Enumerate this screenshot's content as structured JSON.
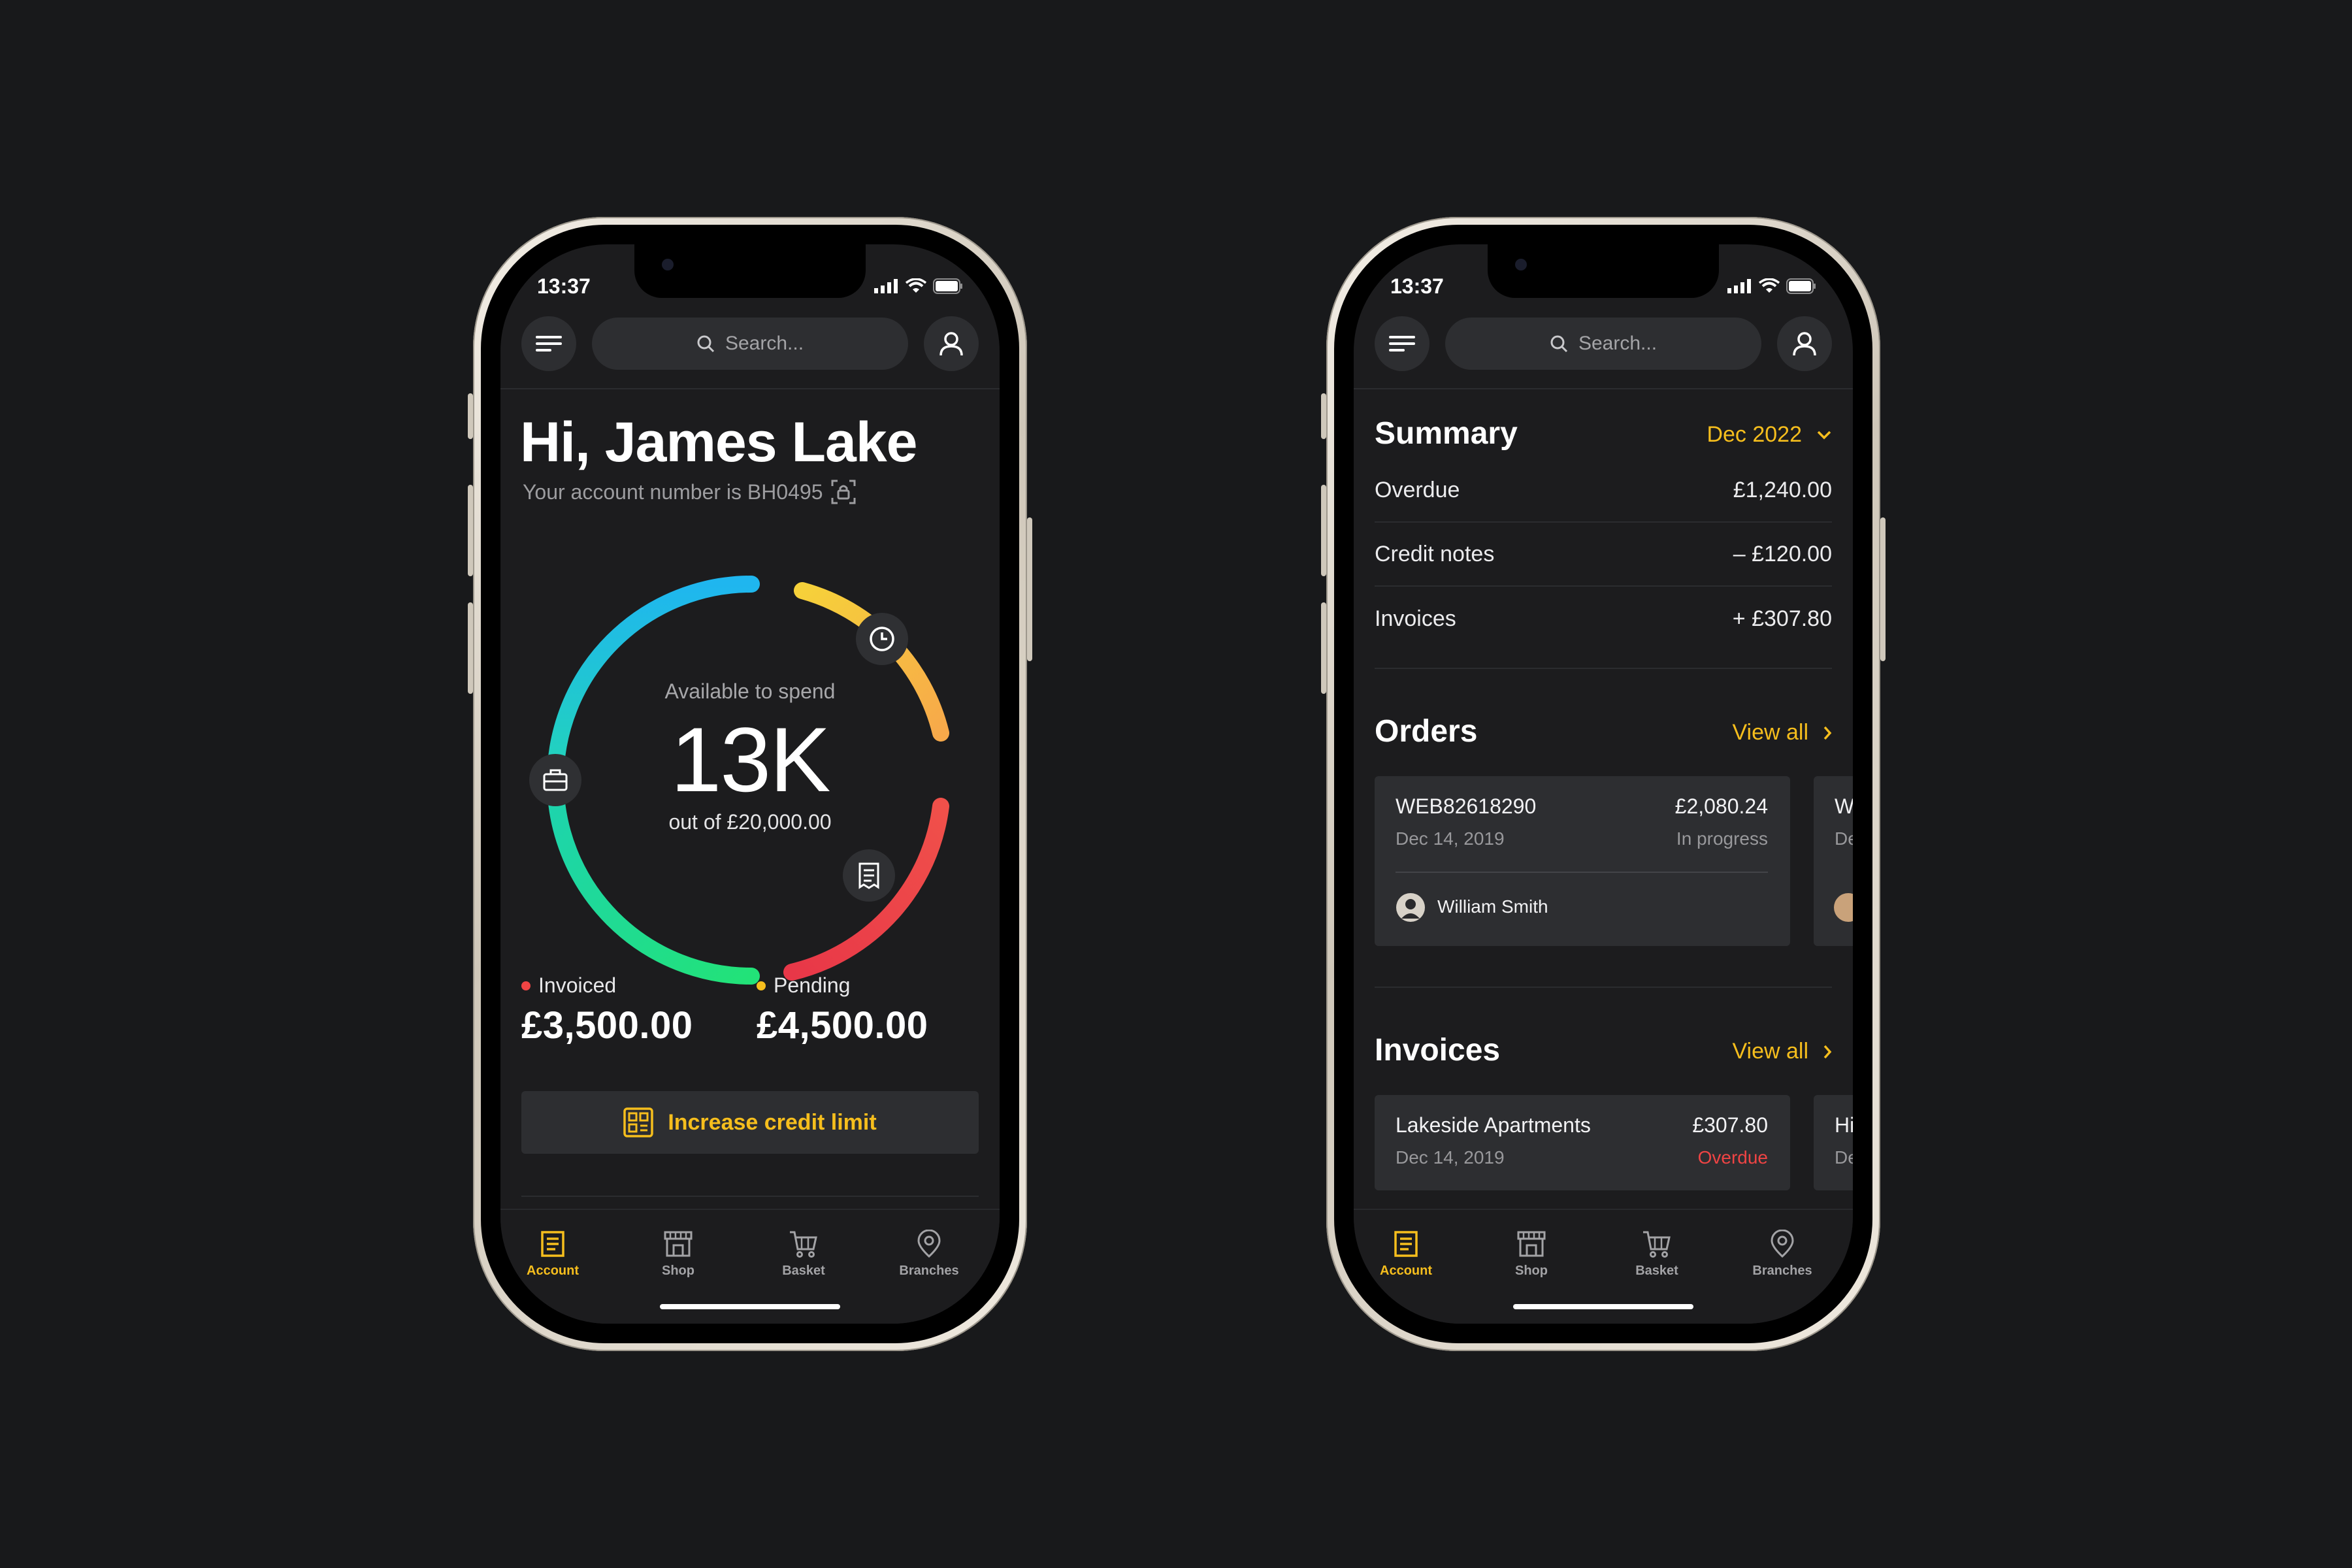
{
  "status_time": "13:37",
  "search_placeholder": "Search...",
  "left": {
    "greeting": "Hi, James Lake",
    "account_line": "Your account number is BH0495",
    "gauge": {
      "label": "Available to spend",
      "value": "13K",
      "subtitle": "out of £20,000.00"
    },
    "invoiced": {
      "label": "Invoiced",
      "amount": "£3,500.00",
      "color": "#ef4444"
    },
    "pending": {
      "label": "Pending",
      "amount": "£4,500.00",
      "color": "#f6be1d"
    },
    "credit_button": "Increase credit limit"
  },
  "right": {
    "summary": {
      "title": "Summary",
      "period": "Dec 2022",
      "rows": [
        {
          "label": "Overdue",
          "value": "£1,240.00"
        },
        {
          "label": "Credit notes",
          "value": "– £120.00"
        },
        {
          "label": "Invoices",
          "value": "+ £307.80"
        }
      ]
    },
    "orders": {
      "title": "Orders",
      "view_all": "View all",
      "card": {
        "id": "WEB82618290",
        "date": "Dec 14, 2019",
        "amount": "£2,080.24",
        "status": "In progress",
        "person": "William Smith"
      },
      "peek": {
        "t1": "W",
        "t2": "De"
      }
    },
    "invoices": {
      "title": "Invoices",
      "view_all": "View all",
      "card": {
        "name": "Lakeside Apartments",
        "date": "Dec 14, 2019",
        "amount": "£307.80",
        "status": "Overdue"
      },
      "peek": {
        "t1": "Hi",
        "t2": "De"
      }
    }
  },
  "tabs": [
    {
      "label": "Account",
      "icon": "account-icon",
      "active": true
    },
    {
      "label": "Shop",
      "icon": "shop-icon",
      "active": false
    },
    {
      "label": "Basket",
      "icon": "basket-icon",
      "active": false
    },
    {
      "label": "Branches",
      "icon": "branches-icon",
      "active": false
    }
  ],
  "colors": {
    "accent": "#f6be1d",
    "overdue": "#ef4444",
    "background": "#1c1c1e"
  }
}
